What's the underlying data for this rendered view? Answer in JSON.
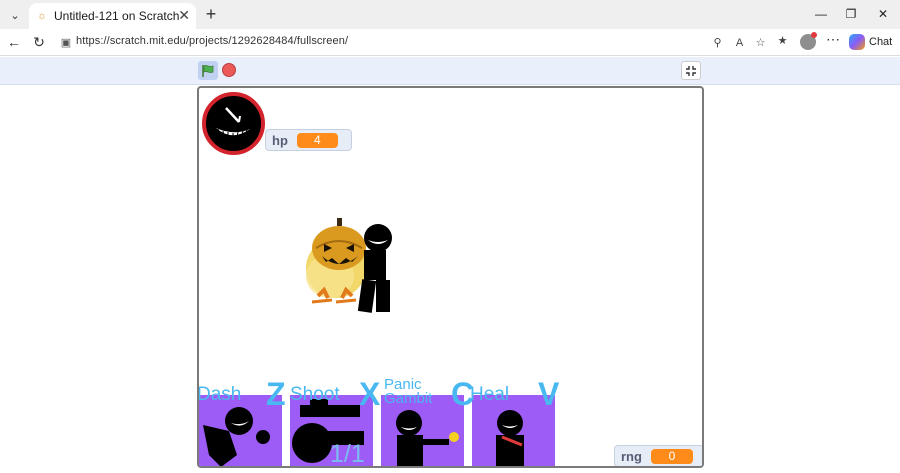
{
  "browser": {
    "tab_title": "Untitled-121 on Scratch",
    "url": "https://scratch.mit.edu/projects/1292628484/fullscreen/",
    "copilot_label": "Chat",
    "icons": [
      "tab-menu-icon",
      "scratch-favicon-icon",
      "close-icon",
      "new-tab-icon",
      "minimize-icon",
      "restore-icon",
      "window-close-icon",
      "back-icon",
      "refresh-icon",
      "lock-icon",
      "zoom-icon",
      "read-aloud-icon",
      "favorite-icon",
      "collections-icon",
      "profile-icon",
      "more-icon",
      "copilot-icon"
    ]
  },
  "scratch": {
    "colors": {
      "flag": "#4caf50",
      "stop": "#ec5959",
      "monitor_value": "#ff8c1a",
      "ability_panel": "#9d5cf5",
      "ability_text": "#4ab8f0"
    },
    "monitors": {
      "hp": {
        "label": "hp",
        "value": "4"
      },
      "rng": {
        "label": "rng",
        "value": "0"
      }
    },
    "abilities": [
      {
        "label": "Dash",
        "key": "Z"
      },
      {
        "label": "Shoot",
        "key": "X"
      },
      {
        "label": "Panic\nGambit",
        "key": "C"
      },
      {
        "label": "Heal",
        "key": "V"
      }
    ],
    "ammo_counter": "1/1"
  }
}
